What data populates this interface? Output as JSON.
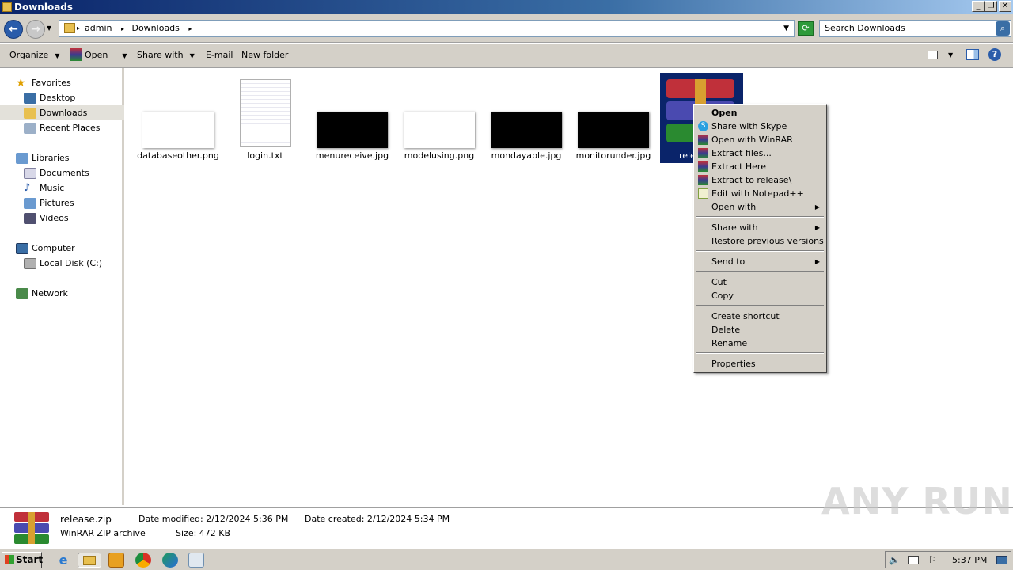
{
  "window": {
    "title": "Downloads"
  },
  "address": {
    "crumbs": [
      "admin",
      "Downloads"
    ],
    "search_placeholder": "Search Downloads"
  },
  "toolbar": {
    "organize": "Organize",
    "open": "Open",
    "share_with": "Share with",
    "email": "E-mail",
    "new_folder": "New folder"
  },
  "nav": {
    "favorites": "Favorites",
    "desktop": "Desktop",
    "downloads": "Downloads",
    "recent_places": "Recent Places",
    "libraries": "Libraries",
    "documents": "Documents",
    "music": "Music",
    "pictures": "Pictures",
    "videos": "Videos",
    "computer": "Computer",
    "local_disk": "Local Disk (C:)",
    "network": "Network"
  },
  "files": [
    {
      "name": "databaseother.png"
    },
    {
      "name": "login.txt"
    },
    {
      "name": "menureceive.jpg"
    },
    {
      "name": "modelusing.png"
    },
    {
      "name": "mondayable.jpg"
    },
    {
      "name": "monitorunder.jpg"
    },
    {
      "name": "rele"
    }
  ],
  "context_menu": {
    "open": "Open",
    "share_skype": "Share with Skype",
    "open_winrar": "Open with WinRAR",
    "extract_files": "Extract files...",
    "extract_here": "Extract Here",
    "extract_to": "Extract to release\\",
    "edit_notepad": "Edit with Notepad++",
    "open_with": "Open with",
    "share_with": "Share with",
    "restore": "Restore previous versions",
    "send_to": "Send to",
    "cut": "Cut",
    "copy": "Copy",
    "create_shortcut": "Create shortcut",
    "delete": "Delete",
    "rename": "Rename",
    "properties": "Properties"
  },
  "details": {
    "filename": "release.zip",
    "type": "WinRAR ZIP archive",
    "date_modified": "Date modified: 2/12/2024 5:36 PM",
    "size": "Size:  472 KB",
    "date_created": "Date created: 2/12/2024 5:34 PM"
  },
  "taskbar": {
    "start": "Start",
    "clock": "5:37 PM"
  },
  "watermark": "ANY RUN",
  "colors": {
    "selection": "#0a246a",
    "face": "#d4d0c8"
  }
}
